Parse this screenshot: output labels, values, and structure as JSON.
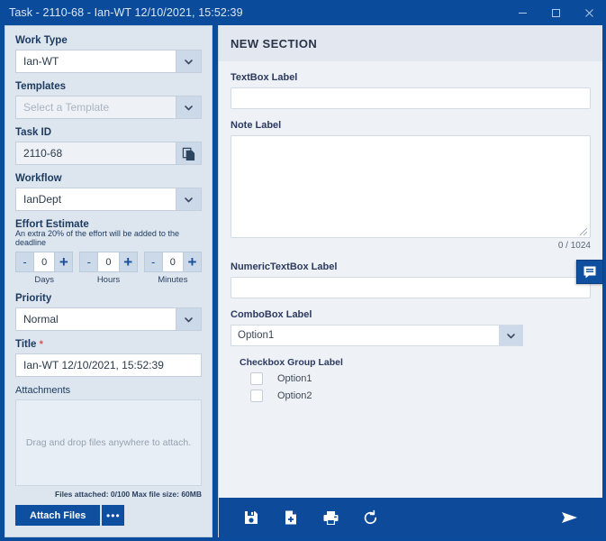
{
  "window": {
    "title": "Task - 2110-68 - Ian-WT 12/10/2021, 15:52:39",
    "controls": {
      "minimize": "minimize-icon",
      "maximize": "maximize-icon",
      "close": "close-icon"
    },
    "accent_color": "#0b4b9c",
    "sidebar_bg": "#dde5ef",
    "main_bg": "#eef1f6"
  },
  "sidebar": {
    "work_type": {
      "label": "Work Type",
      "value": "Ian-WT"
    },
    "templates": {
      "label": "Templates",
      "placeholder": "Select a Template",
      "value": ""
    },
    "task_id": {
      "label": "Task ID",
      "value": "2110-68",
      "copy_icon": "copy-icon"
    },
    "workflow": {
      "label": "Workflow",
      "value": "IanDept"
    },
    "effort_estimate": {
      "label": "Effort Estimate",
      "note": "An extra 20% of the effort will be added to the deadline",
      "units": [
        {
          "caption": "Days",
          "value": "0",
          "minus": "-",
          "plus": "+"
        },
        {
          "caption": "Hours",
          "value": "0",
          "minus": "-",
          "plus": "+"
        },
        {
          "caption": "Minutes",
          "value": "0",
          "minus": "-",
          "plus": "+"
        }
      ]
    },
    "priority": {
      "label": "Priority",
      "value": "Normal"
    },
    "title": {
      "label": "Title",
      "required_marker": "*",
      "value": "Ian-WT 12/10/2021, 15:52:39"
    },
    "attachments": {
      "label": "Attachments",
      "dropzone_text": "Drag and drop files anywhere to attach.",
      "meta": "Files attached: 0/100 Max file size: 60MB",
      "attach_button": "Attach Files",
      "more_button": "•••"
    }
  },
  "main": {
    "section_title": "NEW SECTION",
    "textbox": {
      "label": "TextBox Label",
      "value": "",
      "placeholder": ""
    },
    "note": {
      "label": "Note Label",
      "value": "",
      "placeholder": "",
      "counter": "0 / 1024"
    },
    "numeric": {
      "label": "NumericTextBox Label",
      "value": "",
      "placeholder": ""
    },
    "combobox": {
      "label": "ComboBox Label",
      "value": "Option1"
    },
    "checkbox_group": {
      "label": "Checkbox Group Label",
      "options": [
        {
          "label": "Option1",
          "checked": false
        },
        {
          "label": "Option2",
          "checked": false
        }
      ]
    }
  },
  "toolbar": {
    "save": {
      "name": "save-icon",
      "label": "Save"
    },
    "new": {
      "name": "new-document-icon",
      "label": "New"
    },
    "print": {
      "name": "print-icon",
      "label": "Print"
    },
    "reset": {
      "name": "refresh-icon",
      "label": "Reset"
    },
    "submit": {
      "name": "send-icon",
      "label": "Submit"
    }
  },
  "chat_tab": {
    "icon": "comment-icon",
    "label": "Comments"
  }
}
